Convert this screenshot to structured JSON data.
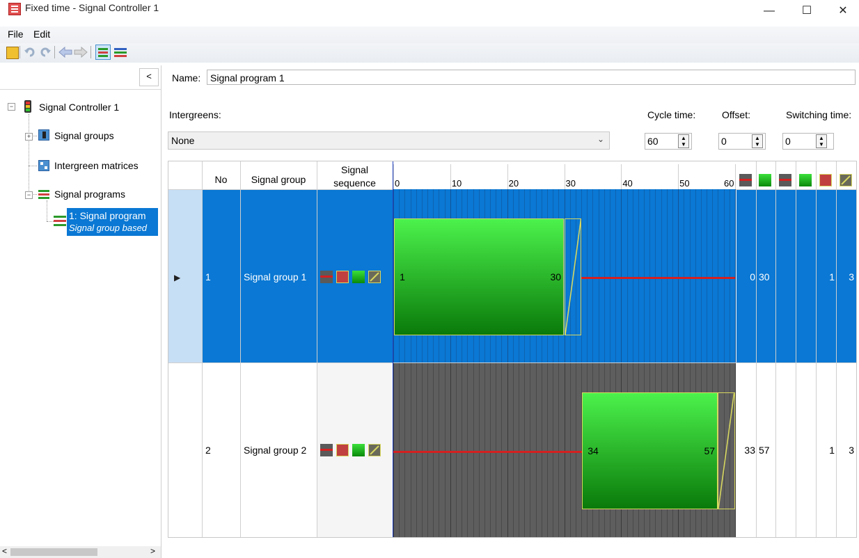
{
  "window": {
    "title": "Fixed time - Signal Controller 1",
    "minimize": "—",
    "maximize": "☐",
    "close": "✕"
  },
  "menu": {
    "file": "File",
    "edit": "Edit"
  },
  "left_panel": {
    "collapse_label": "<",
    "tree": {
      "controller": "Signal Controller 1",
      "signal_groups": "Signal groups",
      "intergreen_matrices": "Intergreen matrices",
      "signal_programs": "Signal programs",
      "program_line1": "1: Signal program",
      "program_line2": "Signal group based"
    }
  },
  "form": {
    "name_label": "Name:",
    "name_value": "Signal program 1",
    "intergreens_label": "Intergreens:",
    "intergreens_value": "None",
    "cycle_time_label": "Cycle time:",
    "cycle_time_value": "60",
    "offset_label": "Offset:",
    "offset_value": "0",
    "switching_time_label": "Switching time:",
    "switching_time_value": "0"
  },
  "grid": {
    "headers": {
      "no": "No",
      "signal_group": "Signal group",
      "signal_sequence_1": "Signal",
      "signal_sequence_2": "sequence"
    },
    "time_ticks": [
      "0",
      "10",
      "20",
      "30",
      "40",
      "50",
      "60"
    ],
    "cycle_length": 60,
    "rows": [
      {
        "no": "1",
        "name": "Signal group 1",
        "green_start": 1,
        "green_end": 30,
        "start_label": "1",
        "end_label": "30",
        "col_a": "0",
        "col_b": "30",
        "col_c": "",
        "col_d": "1",
        "col_e": "3",
        "selected": true
      },
      {
        "no": "2",
        "name": "Signal group 2",
        "green_start": 34,
        "green_end": 57,
        "start_label": "34",
        "end_label": "57",
        "col_a": "33",
        "col_b": "57",
        "col_c": "",
        "col_d": "1",
        "col_e": "3",
        "selected": false
      }
    ]
  },
  "colors": {
    "selection": "#0a78d4",
    "green_top": "#4cf24c",
    "green_bottom": "#0a7a0a",
    "red": "#d42020",
    "amber": "#d8d860",
    "dark_gray": "#5a5a5a"
  }
}
